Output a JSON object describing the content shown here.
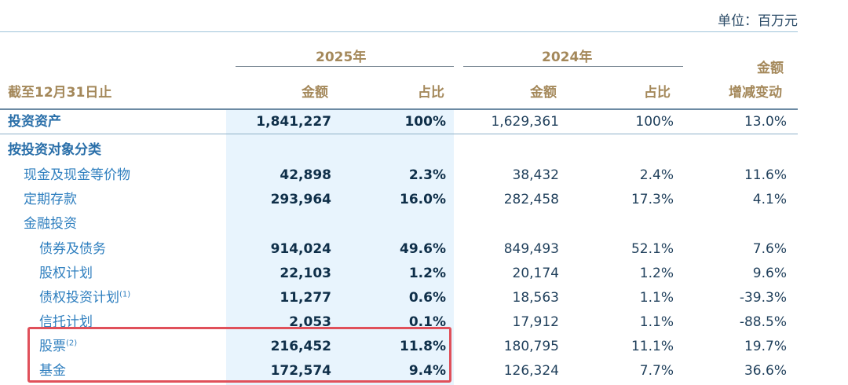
{
  "unit": "单位：百万元",
  "header": {
    "row_label": "截至12月31日止",
    "year_2025": "2025年",
    "year_2024": "2024年",
    "amount": "金额",
    "ratio": "占比",
    "change_line1": "金额",
    "change_line2": "增减变动"
  },
  "rows": [
    {
      "label": "投资资产",
      "sup": "",
      "a2025": "1,841,227",
      "r2025": "100%",
      "a2024": "1,629,361",
      "r2024": "100%",
      "chg": "13.0%"
    },
    {
      "label": "按投资对象分类",
      "sup": "",
      "a2025": "",
      "r2025": "",
      "a2024": "",
      "r2024": "",
      "chg": ""
    },
    {
      "label": "现金及现金等价物",
      "sup": "",
      "a2025": "42,898",
      "r2025": "2.3%",
      "a2024": "38,432",
      "r2024": "2.4%",
      "chg": "11.6%"
    },
    {
      "label": "定期存款",
      "sup": "",
      "a2025": "293,964",
      "r2025": "16.0%",
      "a2024": "282,458",
      "r2024": "17.3%",
      "chg": "4.1%"
    },
    {
      "label": "金融投资",
      "sup": "",
      "a2025": "",
      "r2025": "",
      "a2024": "",
      "r2024": "",
      "chg": ""
    },
    {
      "label": "债券及债务",
      "sup": "",
      "a2025": "914,024",
      "r2025": "49.6%",
      "a2024": "849,493",
      "r2024": "52.1%",
      "chg": "7.6%"
    },
    {
      "label": "股权计划",
      "sup": "",
      "a2025": "22,103",
      "r2025": "1.2%",
      "a2024": "20,174",
      "r2024": "1.2%",
      "chg": "9.6%"
    },
    {
      "label": "债权投资计划",
      "sup": "(1)",
      "a2025": "11,277",
      "r2025": "0.6%",
      "a2024": "18,563",
      "r2024": "1.1%",
      "chg": "-39.3%"
    },
    {
      "label": "信托计划",
      "sup": "",
      "a2025": "2,053",
      "r2025": "0.1%",
      "a2024": "17,912",
      "r2024": "1.1%",
      "chg": "-88.5%"
    },
    {
      "label": "股票",
      "sup": "(2)",
      "a2025": "216,452",
      "r2025": "11.8%",
      "a2024": "180,795",
      "r2024": "11.1%",
      "chg": "19.7%"
    },
    {
      "label": "基金",
      "sup": "",
      "a2025": "172,574",
      "r2025": "9.4%",
      "a2024": "126,324",
      "r2024": "7.7%",
      "chg": "36.6%"
    }
  ]
}
